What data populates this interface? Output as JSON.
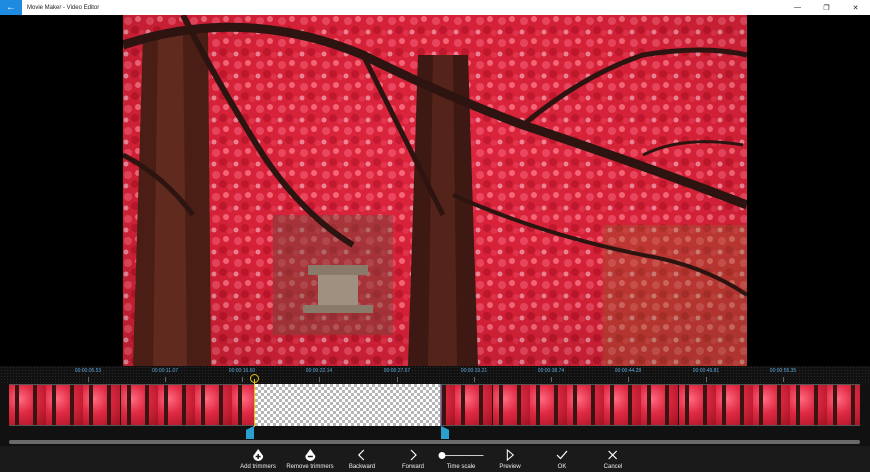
{
  "titlebar": {
    "title": "Movie Maker - Video Editor",
    "back_glyph": "←",
    "minimize_glyph": "—",
    "restore_glyph": "❐",
    "close_glyph": "✕"
  },
  "timeline": {
    "ticks": [
      "00:00:05.53",
      "00:00:11.07",
      "00:00:16.60",
      "00:00:22.14",
      "00:00:27.67",
      "00:00:33.21",
      "00:00:38.74",
      "00:00:44.28",
      "00:00:49.81",
      "00:00:55.35"
    ]
  },
  "toolbar": {
    "add_trimmers": "Add trimmers",
    "remove_trimmers": "Remove trimmers",
    "backward": "Backward",
    "forward": "Forward",
    "time_scale": "Time scale",
    "preview": "Preview",
    "ok": "OK",
    "cancel": "Cancel"
  },
  "icons": {
    "back": "arrow-left-icon",
    "add_trimmers": "trimmer-add-icon",
    "remove_trimmers": "trimmer-remove-icon",
    "backward": "chevron-left-icon",
    "forward": "chevron-right-icon",
    "time_scale": "slider-icon",
    "preview": "play-icon",
    "ok": "check-icon",
    "cancel": "close-icon"
  },
  "colors": {
    "accent": "#1e8be0",
    "playhead": "#e8c000",
    "trimmer": "#2a9fd0",
    "tick_label": "#5fa7d8"
  }
}
